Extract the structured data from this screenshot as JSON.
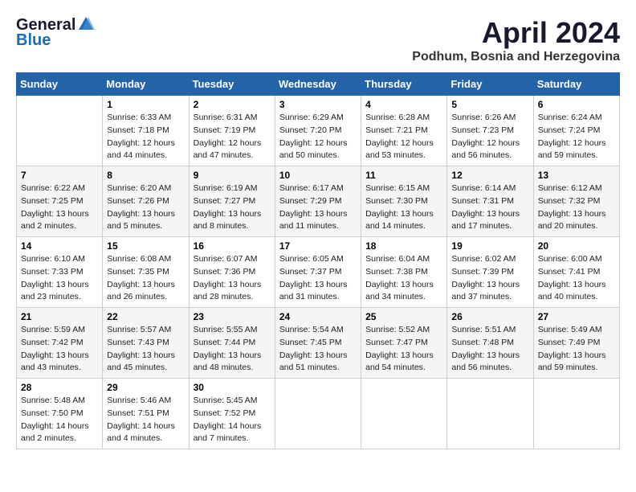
{
  "logo": {
    "general": "General",
    "blue": "Blue"
  },
  "title": "April 2024",
  "location": "Podhum, Bosnia and Herzegovina",
  "days_of_week": [
    "Sunday",
    "Monday",
    "Tuesday",
    "Wednesday",
    "Thursday",
    "Friday",
    "Saturday"
  ],
  "weeks": [
    [
      {
        "day": "",
        "sunrise": "",
        "sunset": "",
        "daylight": ""
      },
      {
        "day": "1",
        "sunrise": "Sunrise: 6:33 AM",
        "sunset": "Sunset: 7:18 PM",
        "daylight": "Daylight: 12 hours and 44 minutes."
      },
      {
        "day": "2",
        "sunrise": "Sunrise: 6:31 AM",
        "sunset": "Sunset: 7:19 PM",
        "daylight": "Daylight: 12 hours and 47 minutes."
      },
      {
        "day": "3",
        "sunrise": "Sunrise: 6:29 AM",
        "sunset": "Sunset: 7:20 PM",
        "daylight": "Daylight: 12 hours and 50 minutes."
      },
      {
        "day": "4",
        "sunrise": "Sunrise: 6:28 AM",
        "sunset": "Sunset: 7:21 PM",
        "daylight": "Daylight: 12 hours and 53 minutes."
      },
      {
        "day": "5",
        "sunrise": "Sunrise: 6:26 AM",
        "sunset": "Sunset: 7:23 PM",
        "daylight": "Daylight: 12 hours and 56 minutes."
      },
      {
        "day": "6",
        "sunrise": "Sunrise: 6:24 AM",
        "sunset": "Sunset: 7:24 PM",
        "daylight": "Daylight: 12 hours and 59 minutes."
      }
    ],
    [
      {
        "day": "7",
        "sunrise": "Sunrise: 6:22 AM",
        "sunset": "Sunset: 7:25 PM",
        "daylight": "Daylight: 13 hours and 2 minutes."
      },
      {
        "day": "8",
        "sunrise": "Sunrise: 6:20 AM",
        "sunset": "Sunset: 7:26 PM",
        "daylight": "Daylight: 13 hours and 5 minutes."
      },
      {
        "day": "9",
        "sunrise": "Sunrise: 6:19 AM",
        "sunset": "Sunset: 7:27 PM",
        "daylight": "Daylight: 13 hours and 8 minutes."
      },
      {
        "day": "10",
        "sunrise": "Sunrise: 6:17 AM",
        "sunset": "Sunset: 7:29 PM",
        "daylight": "Daylight: 13 hours and 11 minutes."
      },
      {
        "day": "11",
        "sunrise": "Sunrise: 6:15 AM",
        "sunset": "Sunset: 7:30 PM",
        "daylight": "Daylight: 13 hours and 14 minutes."
      },
      {
        "day": "12",
        "sunrise": "Sunrise: 6:14 AM",
        "sunset": "Sunset: 7:31 PM",
        "daylight": "Daylight: 13 hours and 17 minutes."
      },
      {
        "day": "13",
        "sunrise": "Sunrise: 6:12 AM",
        "sunset": "Sunset: 7:32 PM",
        "daylight": "Daylight: 13 hours and 20 minutes."
      }
    ],
    [
      {
        "day": "14",
        "sunrise": "Sunrise: 6:10 AM",
        "sunset": "Sunset: 7:33 PM",
        "daylight": "Daylight: 13 hours and 23 minutes."
      },
      {
        "day": "15",
        "sunrise": "Sunrise: 6:08 AM",
        "sunset": "Sunset: 7:35 PM",
        "daylight": "Daylight: 13 hours and 26 minutes."
      },
      {
        "day": "16",
        "sunrise": "Sunrise: 6:07 AM",
        "sunset": "Sunset: 7:36 PM",
        "daylight": "Daylight: 13 hours and 28 minutes."
      },
      {
        "day": "17",
        "sunrise": "Sunrise: 6:05 AM",
        "sunset": "Sunset: 7:37 PM",
        "daylight": "Daylight: 13 hours and 31 minutes."
      },
      {
        "day": "18",
        "sunrise": "Sunrise: 6:04 AM",
        "sunset": "Sunset: 7:38 PM",
        "daylight": "Daylight: 13 hours and 34 minutes."
      },
      {
        "day": "19",
        "sunrise": "Sunrise: 6:02 AM",
        "sunset": "Sunset: 7:39 PM",
        "daylight": "Daylight: 13 hours and 37 minutes."
      },
      {
        "day": "20",
        "sunrise": "Sunrise: 6:00 AM",
        "sunset": "Sunset: 7:41 PM",
        "daylight": "Daylight: 13 hours and 40 minutes."
      }
    ],
    [
      {
        "day": "21",
        "sunrise": "Sunrise: 5:59 AM",
        "sunset": "Sunset: 7:42 PM",
        "daylight": "Daylight: 13 hours and 43 minutes."
      },
      {
        "day": "22",
        "sunrise": "Sunrise: 5:57 AM",
        "sunset": "Sunset: 7:43 PM",
        "daylight": "Daylight: 13 hours and 45 minutes."
      },
      {
        "day": "23",
        "sunrise": "Sunrise: 5:55 AM",
        "sunset": "Sunset: 7:44 PM",
        "daylight": "Daylight: 13 hours and 48 minutes."
      },
      {
        "day": "24",
        "sunrise": "Sunrise: 5:54 AM",
        "sunset": "Sunset: 7:45 PM",
        "daylight": "Daylight: 13 hours and 51 minutes."
      },
      {
        "day": "25",
        "sunrise": "Sunrise: 5:52 AM",
        "sunset": "Sunset: 7:47 PM",
        "daylight": "Daylight: 13 hours and 54 minutes."
      },
      {
        "day": "26",
        "sunrise": "Sunrise: 5:51 AM",
        "sunset": "Sunset: 7:48 PM",
        "daylight": "Daylight: 13 hours and 56 minutes."
      },
      {
        "day": "27",
        "sunrise": "Sunrise: 5:49 AM",
        "sunset": "Sunset: 7:49 PM",
        "daylight": "Daylight: 13 hours and 59 minutes."
      }
    ],
    [
      {
        "day": "28",
        "sunrise": "Sunrise: 5:48 AM",
        "sunset": "Sunset: 7:50 PM",
        "daylight": "Daylight: 14 hours and 2 minutes."
      },
      {
        "day": "29",
        "sunrise": "Sunrise: 5:46 AM",
        "sunset": "Sunset: 7:51 PM",
        "daylight": "Daylight: 14 hours and 4 minutes."
      },
      {
        "day": "30",
        "sunrise": "Sunrise: 5:45 AM",
        "sunset": "Sunset: 7:52 PM",
        "daylight": "Daylight: 14 hours and 7 minutes."
      },
      {
        "day": "",
        "sunrise": "",
        "sunset": "",
        "daylight": ""
      },
      {
        "day": "",
        "sunrise": "",
        "sunset": "",
        "daylight": ""
      },
      {
        "day": "",
        "sunrise": "",
        "sunset": "",
        "daylight": ""
      },
      {
        "day": "",
        "sunrise": "",
        "sunset": "",
        "daylight": ""
      }
    ]
  ]
}
